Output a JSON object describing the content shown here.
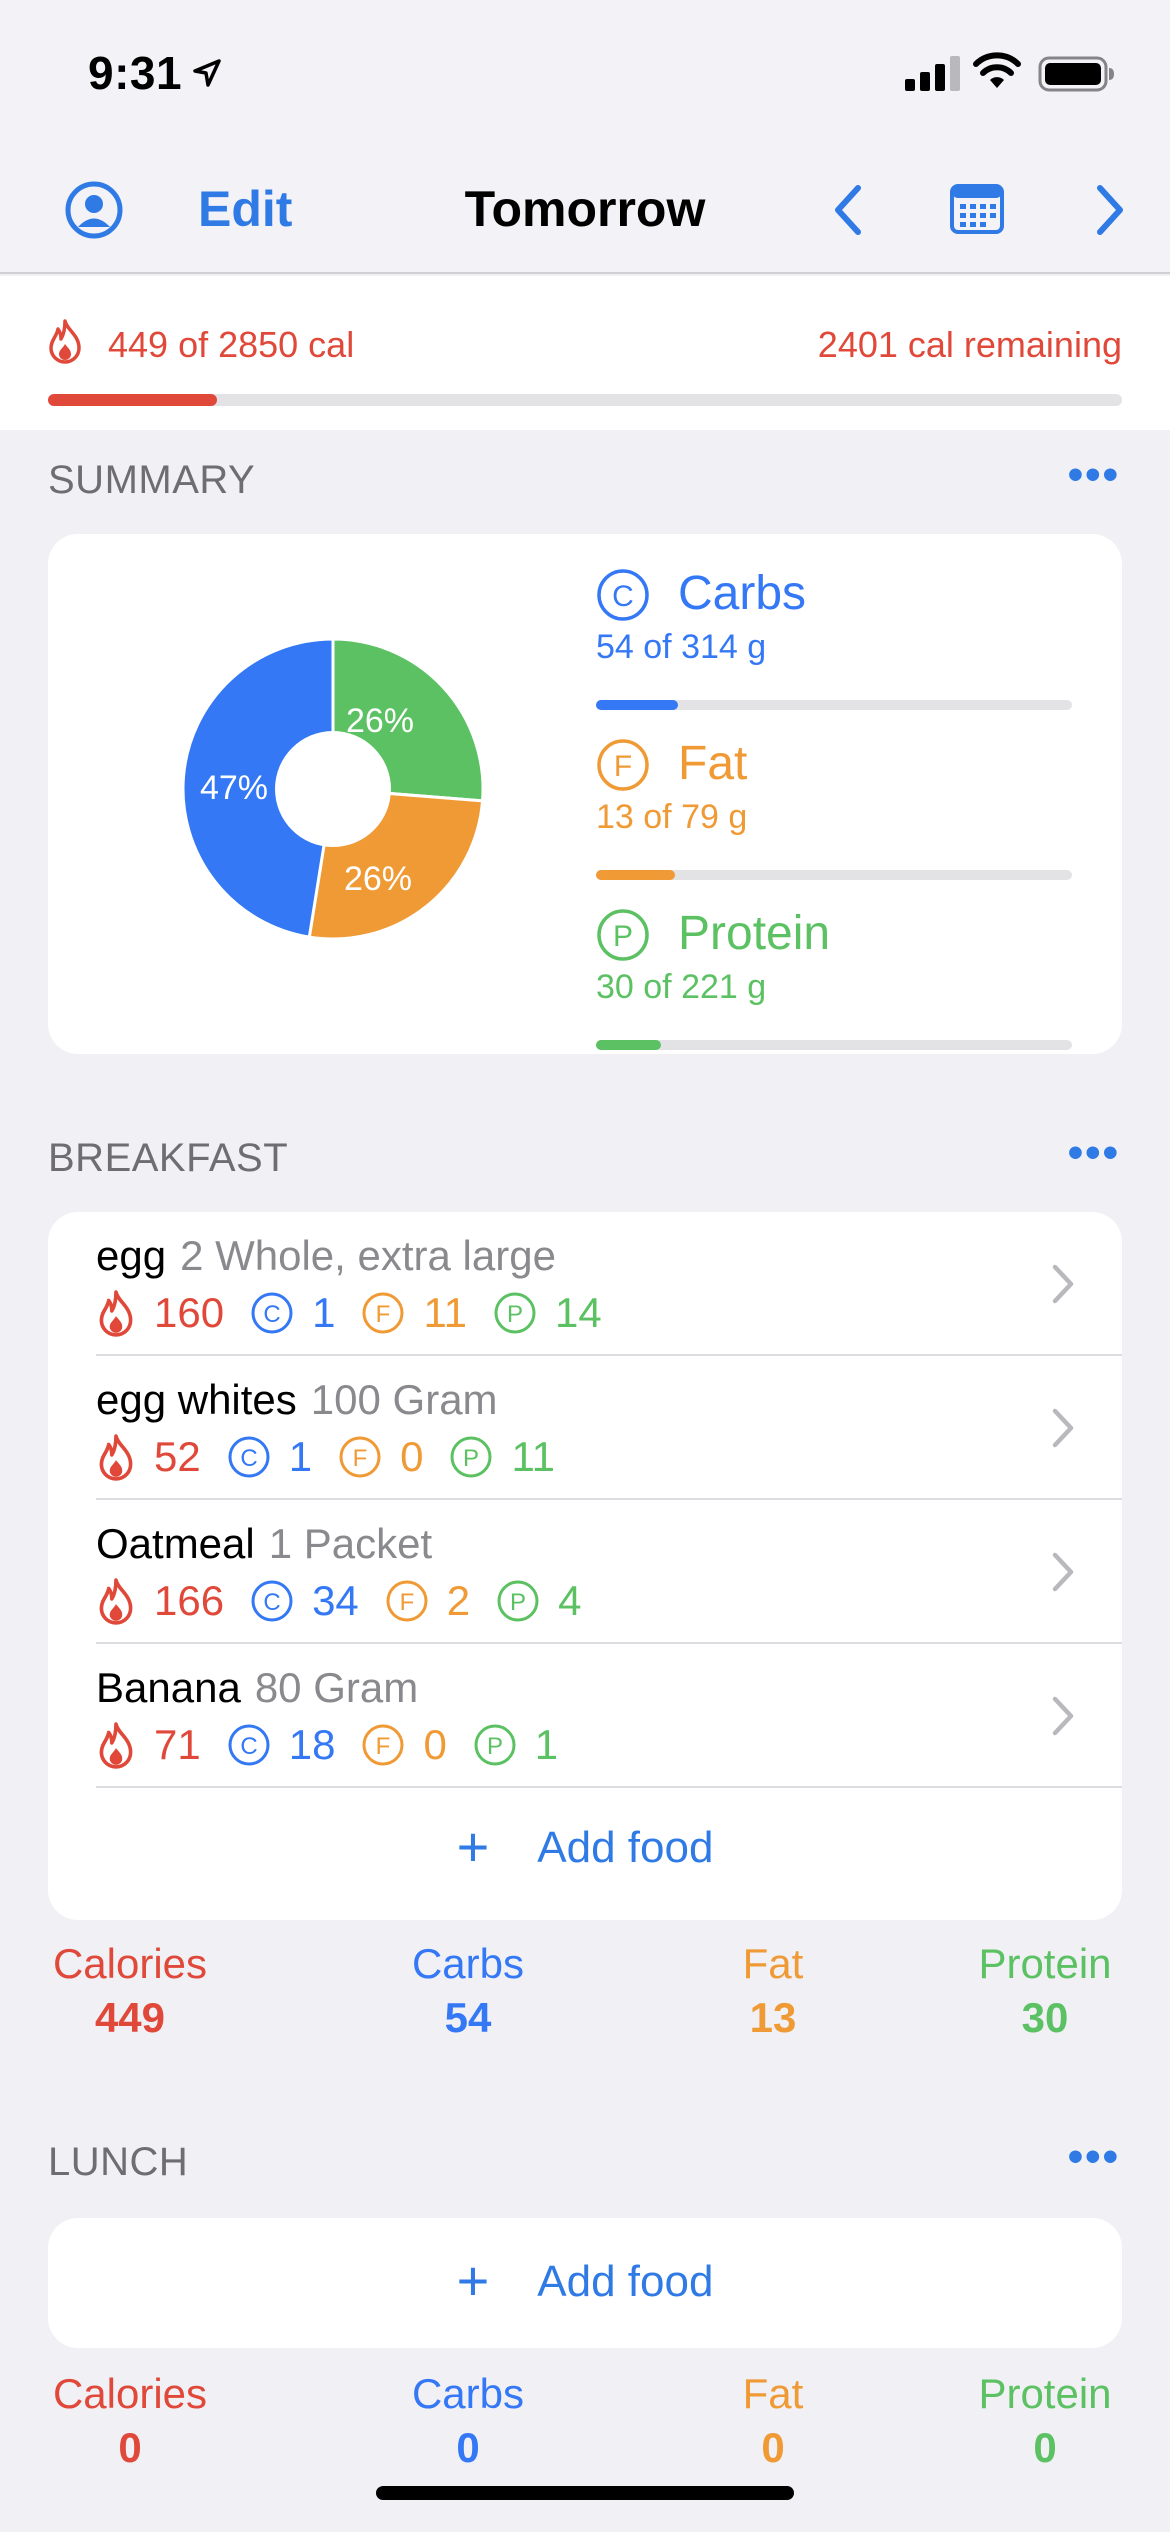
{
  "status": {
    "time": "9:31"
  },
  "nav": {
    "edit": "Edit",
    "title": "Tomorrow"
  },
  "calories": {
    "consumed_text": "449 of 2850 cal",
    "remaining_text": "2401 cal remaining",
    "progress": 0.1575
  },
  "colors": {
    "accent": "#2f7ae5",
    "calories": "#e0483a",
    "carbs": "#3478f6",
    "fat": "#f09a35",
    "protein": "#5cc162"
  },
  "summary": {
    "title": "SUMMARY",
    "more": "•••",
    "pie": {
      "carbs_pct": "47%",
      "fat_pct": "26%",
      "protein_pct": "26%",
      "carbs": 47,
      "fat": 26,
      "protein": 26
    },
    "carbs": {
      "name": "Carbs",
      "letter": "C",
      "amount": "54 of 314 g",
      "progress": 0.172
    },
    "fat": {
      "name": "Fat",
      "letter": "F",
      "amount": "13 of 79 g",
      "progress": 0.165
    },
    "protein": {
      "name": "Protein",
      "letter": "P",
      "amount": "30 of 221 g",
      "progress": 0.136
    }
  },
  "breakfast": {
    "title": "BREAKFAST",
    "more": "•••",
    "items": [
      {
        "name": "egg",
        "portion": "2 Whole, extra large",
        "cal": "160",
        "carbs": "1",
        "fat": "11",
        "protein": "14"
      },
      {
        "name": "egg whites",
        "portion": "100 Gram",
        "cal": "52",
        "carbs": "1",
        "fat": "0",
        "protein": "11"
      },
      {
        "name": "Oatmeal",
        "portion": "1 Packet",
        "cal": "166",
        "carbs": "34",
        "fat": "2",
        "protein": "4"
      },
      {
        "name": "Banana",
        "portion": "80 Gram",
        "cal": "71",
        "carbs": "18",
        "fat": "0",
        "protein": "1"
      }
    ],
    "add_food": "Add food",
    "totals": {
      "calories_label": "Calories",
      "calories": "449",
      "carbs_label": "Carbs",
      "carbs": "54",
      "fat_label": "Fat",
      "fat": "13",
      "protein_label": "Protein",
      "protein": "30"
    }
  },
  "lunch": {
    "title": "LUNCH",
    "more": "•••",
    "add_food": "Add food",
    "totals": {
      "calories_label": "Calories",
      "calories": "0",
      "carbs_label": "Carbs",
      "carbs": "0",
      "fat_label": "Fat",
      "fat": "0",
      "protein_label": "Protein",
      "protein": "0"
    }
  },
  "icons": {
    "profile": "person-circle-icon",
    "prev": "chevron-left-icon",
    "calendar": "calendar-icon",
    "next": "chevron-right-icon",
    "flame": "flame-icon",
    "more": "ellipsis-icon",
    "add": "plus-icon"
  }
}
